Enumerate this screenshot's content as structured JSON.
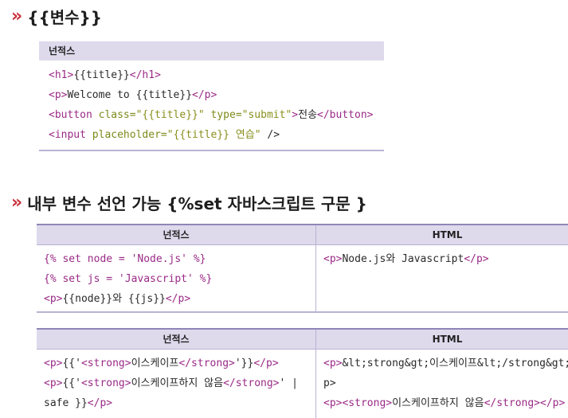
{
  "section1": {
    "chevron": "»",
    "title": "{{변수}}",
    "box_header": "넌적스",
    "lines": [
      [
        [
          "t",
          "<h1>"
        ],
        [
          "p",
          "{{title}}"
        ],
        [
          "t",
          "</h1>"
        ]
      ],
      [
        [
          "t",
          "<p>"
        ],
        [
          "p",
          "Welcome to {{title}}"
        ],
        [
          "t",
          "</p>"
        ]
      ],
      [
        [
          "t",
          "<button "
        ],
        [
          "a",
          "class="
        ],
        [
          "s",
          "\"{{title}}\""
        ],
        [
          "p",
          " "
        ],
        [
          "a",
          "type="
        ],
        [
          "s",
          "\"submit\""
        ],
        [
          "t",
          ">"
        ],
        [
          "p",
          "전송"
        ],
        [
          "t",
          "</button>"
        ]
      ],
      [
        [
          "t",
          "<input "
        ],
        [
          "a",
          "placeholder="
        ],
        [
          "s",
          "\"{{title}} 연습\""
        ],
        [
          "p",
          " />"
        ]
      ]
    ]
  },
  "section2": {
    "chevron": "»",
    "title": "내부 변수 선언 가능 {%set 자바스크립트 구문 }",
    "table1": {
      "col1_header": "넌적스",
      "col2_header": "HTML",
      "col1_lines": [
        [
          [
            "m",
            "{% set node = 'Node.js' %}"
          ]
        ],
        [
          [
            "m",
            "{% set js = 'Javascript' %}"
          ]
        ],
        [
          [
            "t",
            "<p>"
          ],
          [
            "p",
            "{{node}}와 {{js}}"
          ],
          [
            "t",
            "</p>"
          ]
        ]
      ],
      "col2_lines": [
        [
          [
            "t",
            "<p>"
          ],
          [
            "p",
            "Node.js와 Javascript"
          ],
          [
            "t",
            "</p>"
          ]
        ]
      ]
    },
    "table2": {
      "col1_header": "넌적스",
      "col2_header": "HTML",
      "col1_lines": [
        [
          [
            "t",
            "<p>"
          ],
          [
            "p",
            "{{'"
          ],
          [
            "t",
            "<strong>"
          ],
          [
            "p",
            "이스케이프"
          ],
          [
            "t",
            "</strong>"
          ],
          [
            "p",
            "'}}"
          ],
          [
            "t",
            "</p>"
          ]
        ],
        [
          [
            "t",
            "<p>"
          ],
          [
            "p",
            "{{'"
          ],
          [
            "t",
            "<strong>"
          ],
          [
            "p",
            "이스케이프하지 않음"
          ],
          [
            "t",
            "</strong>"
          ],
          [
            "p",
            "' |"
          ]
        ],
        [
          [
            "p",
            "safe }}"
          ],
          [
            "t",
            "</p>"
          ]
        ]
      ],
      "col2_lines": [
        [
          [
            "t",
            "<p>"
          ],
          [
            "p",
            "&lt;strong&gt;이스케이프&lt;/strong&gt;"
          ]
        ],
        [
          [
            "p",
            "p>"
          ]
        ],
        [
          [
            "t",
            "<p><strong>"
          ],
          [
            "p",
            "이스케이프하지 않음"
          ],
          [
            "t",
            "</strong></p>"
          ]
        ]
      ]
    }
  }
}
